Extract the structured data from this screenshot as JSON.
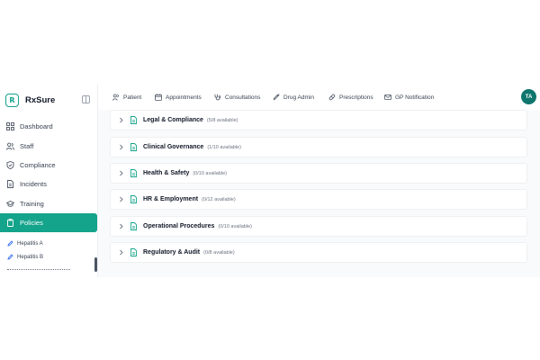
{
  "brand": {
    "name": "RxSure",
    "logo_text": "R",
    "accent_color": "#14a38b"
  },
  "sidebar": {
    "items": [
      {
        "label": "Dashboard",
        "icon": "grid-icon"
      },
      {
        "label": "Staff",
        "icon": "users-icon"
      },
      {
        "label": "Compliance",
        "icon": "shield-icon"
      },
      {
        "label": "Incidents",
        "icon": "document-icon"
      },
      {
        "label": "Training",
        "icon": "graduation-cap-icon"
      },
      {
        "label": "Policies",
        "icon": "clipboard-icon",
        "active": true
      }
    ],
    "sub_items": [
      {
        "label": "Hepatitis A",
        "icon": "pen-icon"
      },
      {
        "label": "Hepatitis B",
        "icon": "pen-icon"
      }
    ]
  },
  "topnav": {
    "tabs": [
      {
        "label": "Patient",
        "icon": "users-icon"
      },
      {
        "label": "Appointments",
        "icon": "calendar-icon"
      },
      {
        "label": "Consultations",
        "icon": "stethoscope-icon"
      },
      {
        "label": "Drug Admin",
        "icon": "syringe-icon"
      },
      {
        "label": "Prescriptions",
        "icon": "pill-icon"
      },
      {
        "label": "GP Notification",
        "icon": "mail-icon"
      }
    ],
    "avatar": "TA"
  },
  "policies": [
    {
      "title": "Legal & Compliance",
      "count": "(5/8 available)"
    },
    {
      "title": "Clinical Governance",
      "count": "(1/10 available)"
    },
    {
      "title": "Health & Safety",
      "count": "(0/10 available)"
    },
    {
      "title": "HR & Employment",
      "count": "(0/12 available)"
    },
    {
      "title": "Operational Procedures",
      "count": "(0/10 available)"
    },
    {
      "title": "Regulatory & Audit",
      "count": "(0/8 available)"
    }
  ]
}
